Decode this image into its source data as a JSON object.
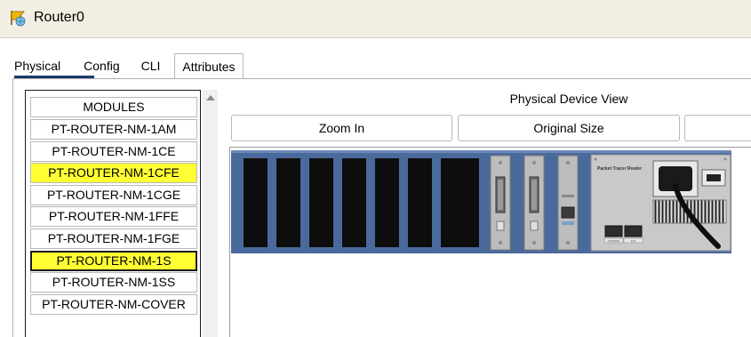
{
  "window": {
    "title": "Router0"
  },
  "tabs": [
    {
      "label": "Physical",
      "active": true
    },
    {
      "label": "Config",
      "active": false
    },
    {
      "label": "CLI",
      "active": false
    },
    {
      "label": "Attributes",
      "active": false
    }
  ],
  "modules": {
    "header": "MODULES",
    "items": [
      {
        "label": "PT-ROUTER-NM-1AM",
        "highlighted": false,
        "selected": false
      },
      {
        "label": "PT-ROUTER-NM-1CE",
        "highlighted": false,
        "selected": false
      },
      {
        "label": "PT-ROUTER-NM-1CFE",
        "highlighted": true,
        "selected": false
      },
      {
        "label": "PT-ROUTER-NM-1CGE",
        "highlighted": false,
        "selected": false
      },
      {
        "label": "PT-ROUTER-NM-1FFE",
        "highlighted": false,
        "selected": false
      },
      {
        "label": "PT-ROUTER-NM-1FGE",
        "highlighted": false,
        "selected": false
      },
      {
        "label": "PT-ROUTER-NM-1S",
        "highlighted": true,
        "selected": true
      },
      {
        "label": "PT-ROUTER-NM-1SS",
        "highlighted": false,
        "selected": false
      },
      {
        "label": "PT-ROUTER-NM-COVER",
        "highlighted": false,
        "selected": false
      }
    ]
  },
  "device_view": {
    "title": "Physical Device View",
    "zoom_in_label": "Zoom In",
    "original_size_label": "Original Size",
    "brand_label": "Packet Tracer Router",
    "console_label": "CONSOLE",
    "aux_label": "AUX"
  },
  "colors": {
    "highlight": "#ffff33",
    "chassis": "#4a6a9c",
    "title_bg": "#f2efe2",
    "tab_underline": "#1b3a67"
  }
}
